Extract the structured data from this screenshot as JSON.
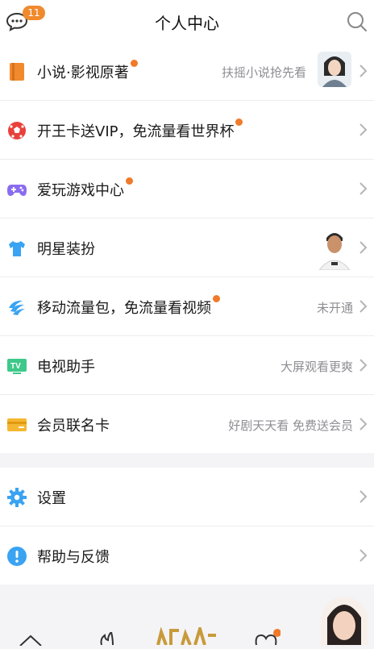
{
  "header": {
    "title": "个人中心",
    "message_badge": "11"
  },
  "menu": [
    {
      "label": "小说·影视原著",
      "sub": "扶摇小说抢先看",
      "icon": "book-icon",
      "color": "#f08a2d"
    },
    {
      "label": "开王卡送VIP，免流量看世界杯",
      "sub": "",
      "icon": "football-icon",
      "color": "#e8413c"
    },
    {
      "label": "爱玩游戏中心",
      "sub": "",
      "icon": "gamepad-icon",
      "color": "#8a6cf0"
    },
    {
      "label": "明星装扮",
      "sub": "",
      "icon": "tshirt-icon",
      "color": "#3aa3f2"
    },
    {
      "label": "移动流量包，免流量看视频",
      "sub": "未开通",
      "icon": "china-mobile-icon",
      "color": "#3aa3f2"
    },
    {
      "label": "电视助手",
      "sub": "大屏观看更爽",
      "icon": "tv-icon",
      "color": "#3ec88a"
    },
    {
      "label": "会员联名卡",
      "sub": "好剧天天看 免费送会员",
      "icon": "card-icon",
      "color": "#f5b731"
    }
  ],
  "settings_menu": [
    {
      "label": "设置",
      "icon": "gear-icon",
      "color": "#3aa3f2"
    },
    {
      "label": "帮助与反馈",
      "icon": "help-icon",
      "color": "#3aa3f2"
    }
  ],
  "colors": {
    "accent": "#f07a2a",
    "badge": "#f08a2d",
    "chevron": "#b5b5b5"
  }
}
